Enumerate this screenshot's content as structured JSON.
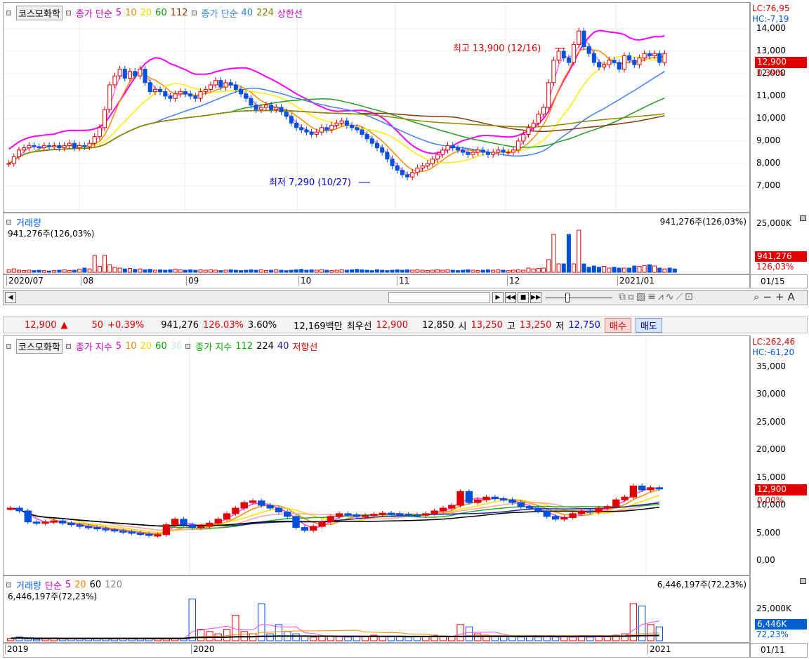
{
  "top_chart": {
    "name": "코스모화학",
    "legend1": {
      "label": "종가 단순",
      "p5": "5",
      "p10": "10",
      "p20": "20",
      "p60": "60",
      "p112": "112"
    },
    "legend2": {
      "label": "종가 단순",
      "p40": "40",
      "p224": "224",
      "band": "상한선"
    },
    "lc": "LC:76,95",
    "hc": "HC:-7,19",
    "y_ticks": [
      "14,000",
      "13,000",
      "12,000",
      "11,000",
      "10,000",
      "9,000",
      "8,000",
      "7,000"
    ],
    "current_price": "12,900",
    "current_pct": "0,39%",
    "high_note": "최고 13,900 (12/16)",
    "low_note": "최저 7,290 (10/27)",
    "x_labels": [
      "2020/07",
      "08",
      "09",
      "10",
      "11",
      "12",
      "2021/01"
    ],
    "x_right": "01/15",
    "volume": {
      "title": "거래량",
      "value": "941,276주(126,03%)",
      "value_right": "941,276주(126,03%)",
      "scale": "25,000K",
      "badge": "941,276",
      "badge_pct": "126,03%"
    },
    "chart_data": {
      "type": "candlestick",
      "ylim": [
        6000,
        15000
      ],
      "closes": [
        8000,
        8300,
        8600,
        8700,
        8800,
        8750,
        8700,
        8800,
        8750,
        8800,
        8700,
        8800,
        8900,
        8700,
        8800,
        8750,
        8900,
        9200,
        9600,
        10400,
        11500,
        11900,
        12200,
        11800,
        12100,
        11900,
        12200,
        11600,
        11200,
        11300,
        11200,
        11000,
        10900,
        11100,
        11200,
        11100,
        11000,
        10900,
        11200,
        11300,
        11500,
        11700,
        11400,
        11600,
        11500,
        11300,
        11100,
        10900,
        10600,
        10400,
        10500,
        10600,
        10400,
        10500,
        10300,
        10100,
        9800,
        9600,
        9500,
        9400,
        9300,
        9400,
        9600,
        9500,
        9700,
        9800,
        9900,
        9700,
        9600,
        9500,
        9300,
        9100,
        8900,
        8700,
        8500,
        8200,
        7900,
        7700,
        7500,
        7400,
        7600,
        7800,
        7900,
        8000,
        8200,
        8400,
        8600,
        8800,
        8700,
        8600,
        8500,
        8400,
        8500,
        8600,
        8500,
        8400,
        8500,
        8600,
        8500,
        8500,
        8600,
        9000,
        9300,
        9600,
        9800,
        10200,
        10500,
        11600,
        12600,
        13000,
        12700,
        12500,
        13300,
        13900,
        13200,
        12900,
        12500,
        12300,
        12400,
        12600,
        12500,
        12200,
        12800,
        12600,
        12400,
        12700,
        12900,
        12800,
        12900,
        12500,
        12900
      ],
      "yellow_line": [
        8300,
        8350,
        8400,
        8450,
        8500,
        8550,
        8600,
        8650,
        8700,
        8750,
        8800,
        9000,
        9300,
        9600,
        9900,
        10200,
        10500,
        10800,
        11000,
        11200,
        11300,
        11300,
        11200,
        11000,
        10800,
        10600,
        10400,
        10200,
        10000,
        9800,
        9600,
        9400,
        9200,
        9000,
        8800,
        8600,
        8500,
        8400,
        8400,
        8400,
        8500,
        8600,
        8700,
        8900,
        9100,
        9500,
        10000,
        10500,
        11000,
        11500,
        12000,
        12300,
        12500,
        12600
      ],
      "volume_bars": [
        0.06,
        0.08,
        0.05,
        0.04,
        0.05,
        0.04,
        0.05,
        0.04,
        0.03,
        0.04,
        0.05,
        0.06,
        0.04,
        0.05,
        0.07,
        0.1,
        0.08,
        0.4,
        0.14,
        0.4,
        0.18,
        0.12,
        0.1,
        0.08,
        0.09,
        0.07,
        0.08,
        0.06,
        0.07,
        0.05,
        0.06,
        0.05,
        0.06,
        0.07,
        0.06,
        0.05,
        0.06,
        0.05,
        0.06,
        0.05,
        0.06,
        0.05,
        0.04,
        0.05,
        0.06,
        0.05,
        0.04,
        0.05,
        0.06,
        0.05,
        0.06,
        0.04,
        0.05,
        0.06,
        0.05,
        0.04,
        0.05,
        0.06,
        0.07,
        0.05,
        0.06,
        0.05,
        0.06,
        0.05,
        0.04,
        0.05,
        0.06,
        0.05,
        0.06,
        0.07,
        0.06,
        0.05,
        0.04,
        0.06,
        0.05,
        0.04,
        0.05,
        0.06,
        0.05,
        0.06,
        0.05,
        0.06,
        0.05,
        0.04,
        0.05,
        0.06,
        0.05,
        0.06,
        0.05,
        0.04,
        0.05,
        0.06,
        0.05,
        0.04,
        0.05,
        0.06,
        0.05,
        0.06,
        0.05,
        0.04,
        0.05,
        0.06,
        0.05,
        0.1,
        0.08,
        0.09,
        0.1,
        0.3,
        0.9,
        0.2,
        0.2,
        0.9,
        0.2,
        1.0,
        0.2,
        0.12,
        0.15,
        0.12,
        0.14,
        0.1,
        0.12,
        0.1,
        0.1,
        0.1,
        0.15,
        0.14,
        0.16,
        0.18,
        0.15,
        0.1,
        0.08,
        0.1,
        0.08
      ]
    }
  },
  "toolbar": {
    "price": "12,900",
    "change": "50",
    "change_pct": "+0.39%",
    "volume": "941,276",
    "vol_pct": "126.03%",
    "turnover_pct": "3.60%",
    "amount": "12,169백만",
    "best_ask_label": "최우선",
    "best_ask": "12,900",
    "best_bid": "12,850",
    "open_label": "시",
    "open": "13,250",
    "high_label": "고",
    "high": "13,250",
    "low_label": "저",
    "low": "12,750",
    "buy_label": "매수",
    "sell_label": "매도"
  },
  "bottom_chart": {
    "name": "코스모화학",
    "legend1": {
      "label": "종가 지수",
      "p5": "5",
      "p10": "10",
      "p20": "20",
      "p60": "60",
      "p36": "36"
    },
    "legend2": {
      "label": "종가 지수",
      "p112": "112",
      "p224": "224",
      "p40": "40",
      "band": "저항선"
    },
    "lc": "LC:262,46",
    "hc": "HC:-61,20",
    "y_ticks": [
      "35,000",
      "30,000",
      "25,000",
      "20,000",
      "15,000",
      "10,000",
      "5,000",
      "0,00"
    ],
    "current_price": "12,900",
    "current_pct": "0,00%",
    "x_labels": [
      "2019",
      "2020",
      "2021"
    ],
    "x_right": "01/11",
    "volume": {
      "title": "거래량",
      "ma_label": "단순",
      "p5": "5",
      "p20": "20",
      "p60": "60",
      "p120": "120",
      "value": "6,446,197주(72,23%)",
      "value_right": "6,446,197주(72,23%)",
      "scale": "25,000K",
      "badge": "6,446K",
      "badge_pct": "72,23%"
    },
    "chart_data": {
      "type": "candlestick",
      "ylim": [
        0,
        38000
      ],
      "closes": [
        9500,
        9000,
        7000,
        6800,
        7000,
        7200,
        6800,
        6500,
        6200,
        6000,
        5800,
        5600,
        5400,
        5200,
        5000,
        4800,
        4600,
        4700,
        6500,
        7500,
        6500,
        6000,
        6200,
        6800,
        7500,
        8500,
        9500,
        10500,
        10800,
        10000,
        9500,
        8800,
        8000,
        6000,
        5500,
        6200,
        7000,
        8000,
        8500,
        8300,
        8000,
        8200,
        8400,
        8600,
        8500,
        8400,
        8300,
        8200,
        8500,
        9000,
        9500,
        10000,
        12500,
        10500,
        11000,
        11500,
        11200,
        11000,
        10500,
        9800,
        9500,
        9000,
        8000,
        7500,
        7800,
        8500,
        9000,
        8800,
        9500,
        9800,
        11000,
        11500,
        13500,
        12800,
        13200,
        13000
      ]
    },
    "volume_bars": [
      0.05,
      0.08,
      0.04,
      0.03,
      0.04,
      0.05,
      0.04,
      0.05,
      0.04,
      0.05,
      0.04,
      0.05,
      0.04,
      0.05,
      0.04,
      0.05,
      0.04,
      0.05,
      0.04,
      0.05,
      0.04,
      0.9,
      0.25,
      0.2,
      0.15,
      0.25,
      0.55,
      0.2,
      0.15,
      0.8,
      0.15,
      0.35,
      0.2,
      0.15,
      0.1,
      0.08,
      0.1,
      0.1,
      0.1,
      0.08,
      0.1,
      0.1,
      0.12,
      0.1,
      0.1,
      0.1,
      0.08,
      0.1,
      0.1,
      0.12,
      0.1,
      0.1,
      0.35,
      0.3,
      0.15,
      0.12,
      0.1,
      0.1,
      0.1,
      0.08,
      0.1,
      0.08,
      0.1,
      0.08,
      0.1,
      0.08,
      0.1,
      0.08,
      0.1,
      0.1,
      0.12,
      0.15,
      0.8,
      0.75,
      0.35,
      0.3
    ]
  }
}
